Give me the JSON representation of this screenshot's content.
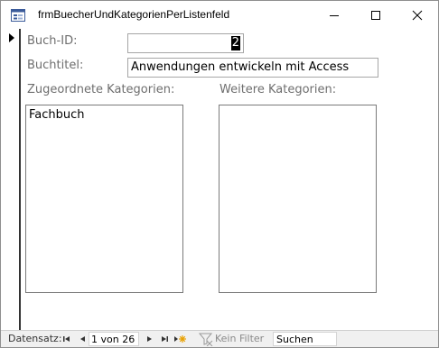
{
  "window": {
    "title": "frmBuecherUndKategorienPerListenfeld",
    "icons": [
      "form-icon",
      "minimize-icon",
      "maximize-icon",
      "close-icon"
    ]
  },
  "form": {
    "book_id_label": "Buch-ID:",
    "book_id_value": "2",
    "book_title_label": "Buchtitel:",
    "book_title_value": "Anwendungen entwickeln mit Access",
    "assigned_categories_label": "Zugeordnete Kategorien:",
    "assigned_categories": [
      "Fachbuch"
    ],
    "more_categories_label": "Weitere Kategorien:",
    "more_categories": []
  },
  "navigation": {
    "record_label": "Datensatz:",
    "position": "1 von 26",
    "filter_label": "Kein Filter",
    "search_placeholder": "Suchen"
  },
  "colors": {
    "label_gray": "#6e6e6e",
    "border_gray": "#a6a6a6",
    "nav_background": "#f0f0f0",
    "new_record_accent": "#e8a000"
  }
}
